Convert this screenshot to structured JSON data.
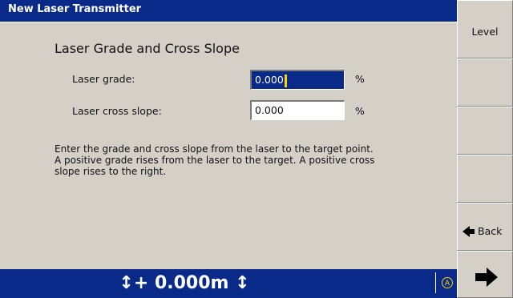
{
  "window": {
    "title": "New Laser Transmitter"
  },
  "form": {
    "heading": "Laser Grade and Cross Slope",
    "fields": [
      {
        "label": "Laser grade:",
        "value": "0.000",
        "unit": "%"
      },
      {
        "label": "Laser cross slope:",
        "value": "0.000",
        "unit": "%"
      }
    ],
    "description_lines": [
      "Enter the grade and cross slope from the laser to the target point.",
      "A positive grade rises from the laser to the target. A positive cross",
      "slope rises to the right."
    ]
  },
  "sidebar": {
    "buttons": [
      {
        "label": "Level"
      },
      {
        "label": ""
      },
      {
        "label": ""
      },
      {
        "label": ""
      },
      {
        "label": "Back"
      },
      {
        "label": ""
      }
    ]
  },
  "status": {
    "elevation": "↕+ 0.000m ↕",
    "icon_glyph": "A"
  },
  "icons": {
    "back": "left-arrow-icon",
    "next": "right-arrow-icon",
    "status": "laser-status-icon"
  },
  "colors": {
    "titlebar": "#0a2a8a",
    "active_field": "#0a2a8a",
    "caret": "#ffd400",
    "panel": "#d4d0c8"
  }
}
